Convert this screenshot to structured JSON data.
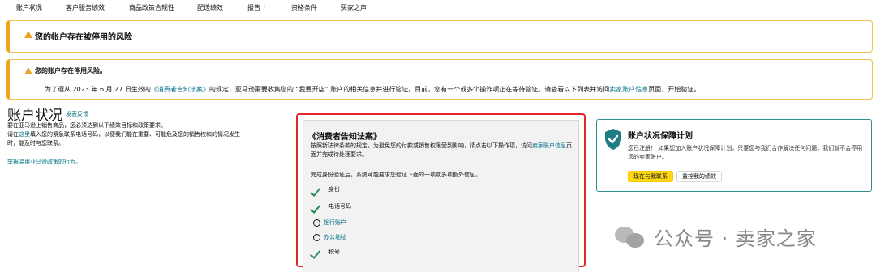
{
  "nav": {
    "items": [
      "账户状况",
      "客户服务绩效",
      "商品政策合规性",
      "配送绩效",
      "报告",
      "资格条件",
      "买家之声"
    ]
  },
  "alerts": {
    "a1_title": "您的帐户存在被停用的风险",
    "a2_title": "您的账户存在停用风险。",
    "a2_body_pre": "为了遵从 2023 年 6 月 27 日生效的",
    "a2_body_link1": "《消费者告知法案》",
    "a2_body_mid": "的规定，亚马逊需要收集您的 “我要开店” 账户的相关信息并进行验证。目前，您有一个或多个操作项正在等待验证。请查看以下列表并访问",
    "a2_body_link2": "卖家账户信息",
    "a2_body_post": "页面，开始验证。"
  },
  "left": {
    "title": "账户状况",
    "feedback": "发表反馈",
    "line1": "要在亚马逊上销售商品，您必须达到以下绩效目标和政策要求。",
    "line2_pre": "请在",
    "line2_link": "这里",
    "line2_post": "填入您的紧急联系电话号码，以便我们能在重要、可能危及您的销售权和的情况发生",
    "line3": "时，能及时与您联系。",
    "report": "举报滥用亚马逊政策的行为。"
  },
  "middle": {
    "title": "《消费者告知法案》",
    "desc_pre": "按照新法律条款的规定，为避免您的付款或销售权限受到影响，请点击以下操作项，访问",
    "desc_link": "卖家账户信息",
    "desc_post": "页面并完成待处理要求。",
    "note": "完成身份验证后，系统可能要求您验证下面的一项或多项额外信息。",
    "items": [
      {
        "label": "身份",
        "state": "done"
      },
      {
        "label": "电话号码",
        "state": "done"
      },
      {
        "label": "银行账户",
        "state": "pending"
      },
      {
        "label": "办公地址",
        "state": "pending"
      },
      {
        "label": "税号",
        "state": "done"
      }
    ]
  },
  "right": {
    "title": "账户状况保障计划",
    "desc": "您已注册！ 如果您加入账户状况保障计划，只要您与我们合作解决任何问题，我们就不会停用您的卖家账户。",
    "btn_contact": "现在与我联系",
    "btn_monitor": "监控我的绩效"
  },
  "watermark": {
    "text": "公众号 · 卖家之家"
  },
  "colors": {
    "link": "#007185",
    "warning": "#f0a520",
    "highlight_border": "#e3242b",
    "check": "#2e8b57",
    "primary_button": "#ffd814",
    "teal_border": "#2a8f8f"
  }
}
